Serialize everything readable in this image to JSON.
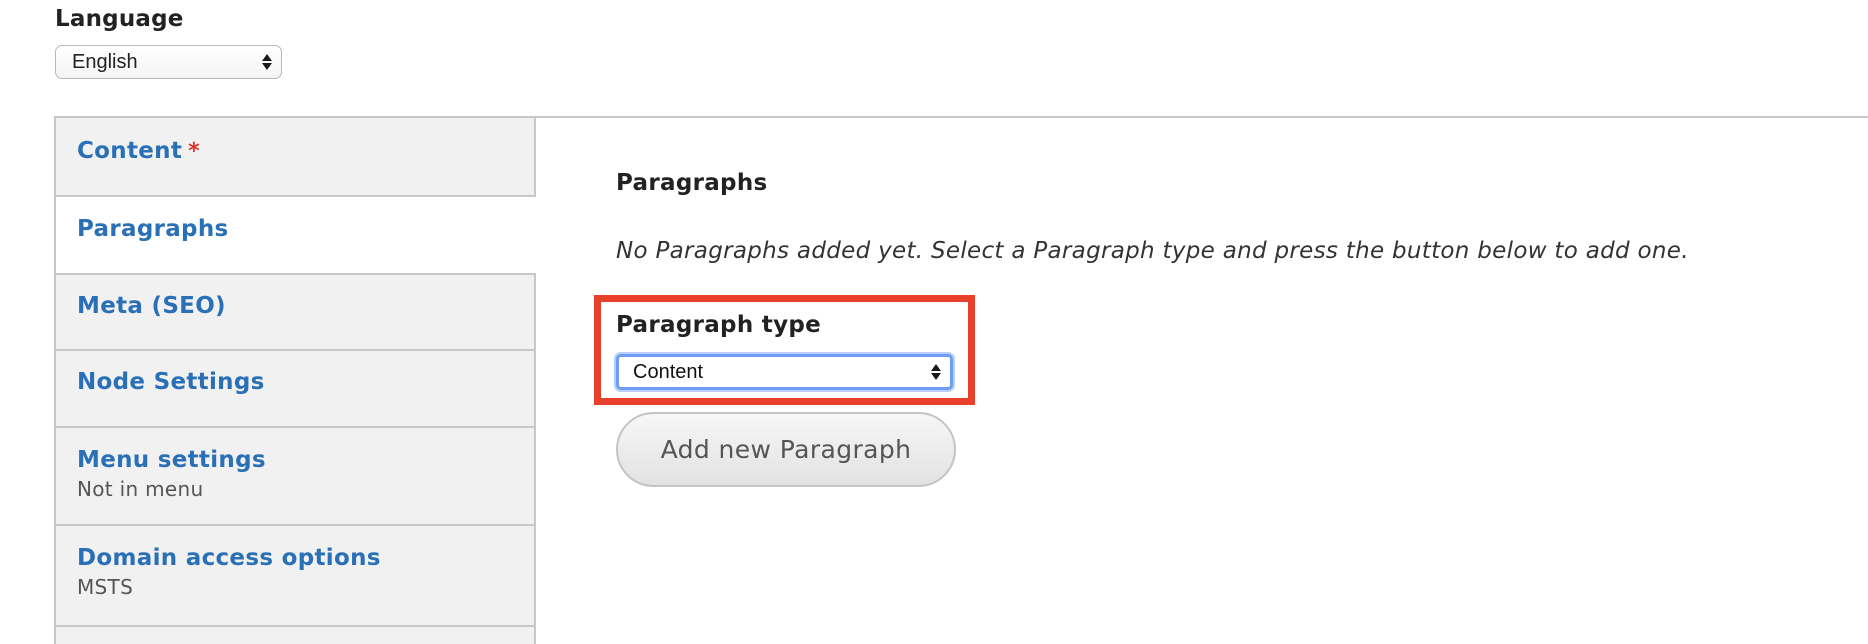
{
  "language": {
    "label": "Language",
    "selected": "English"
  },
  "tabs": [
    {
      "title": "Content",
      "required_marker": "*",
      "summary": ""
    },
    {
      "title": "Paragraphs",
      "required_marker": "",
      "summary": ""
    },
    {
      "title": "Meta (SEO)",
      "required_marker": "",
      "summary": ""
    },
    {
      "title": "Node Settings",
      "required_marker": "",
      "summary": ""
    },
    {
      "title": "Menu settings",
      "required_marker": "",
      "summary": "Not in menu"
    },
    {
      "title": "Domain access options",
      "required_marker": "",
      "summary": "MSTS"
    }
  ],
  "paragraphs_pane": {
    "title": "Paragraphs",
    "empty_message": "No Paragraphs added yet. Select a Paragraph type and press the button below to add one.",
    "type_label": "Paragraph type",
    "type_selected": "Content",
    "add_button_label": "Add new Paragraph"
  },
  "colors": {
    "link": "#2a70b6",
    "required": "#e0322b",
    "highlight_border": "#e8402b",
    "focus_ring": "#6f9cf5"
  }
}
